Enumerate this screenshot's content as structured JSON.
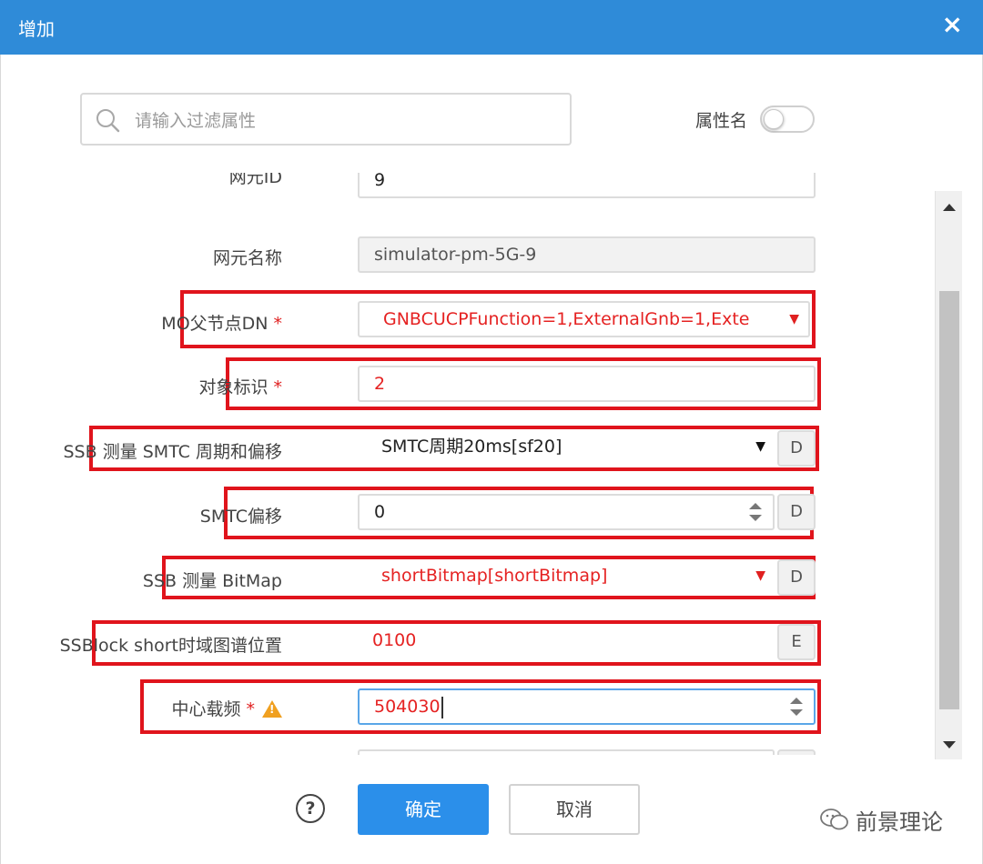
{
  "window": {
    "title": "增加",
    "close_label": "×"
  },
  "filter": {
    "placeholder": "请输入过滤属性",
    "toggle_label": "属性名"
  },
  "form": {
    "partial_label": "网元ID",
    "partial_value": "9",
    "ne_name": {
      "label": "网元名称",
      "value": "simulator-pm-5G-9"
    },
    "mo_parent_dn": {
      "label": "MO父节点DN",
      "required": "*",
      "value": "GNBCUCPFunction=1,ExternalGnb=1,Exte"
    },
    "object_id": {
      "label": "对象标识",
      "required": "*",
      "value": "2"
    },
    "ssb_smtc": {
      "label": "SSB 测量 SMTC 周期和偏移",
      "value": "SMTC周期20ms[sf20]",
      "btn": "D"
    },
    "smtc_offset": {
      "label": "SMTC偏移",
      "value": "0",
      "btn": "D"
    },
    "ssb_bitmap": {
      "label": "SSB 测量 BitMap",
      "value": "shortBitmap[shortBitmap]",
      "btn": "D"
    },
    "ssblock_short": {
      "label": "SSBlock short时域图谱位置",
      "value": "0100",
      "btn": "E"
    },
    "center_freq": {
      "label": "中心载频",
      "required": "*",
      "value": "504030"
    }
  },
  "footer": {
    "ok_label": "确定",
    "cancel_label": "取消",
    "help_label": "?"
  },
  "watermark": {
    "text": "前景理论"
  },
  "colors": {
    "titlebar": "#2f8bd8",
    "primary_button": "#2b8fea",
    "highlight": "#e0141c",
    "required": "#e02020"
  }
}
